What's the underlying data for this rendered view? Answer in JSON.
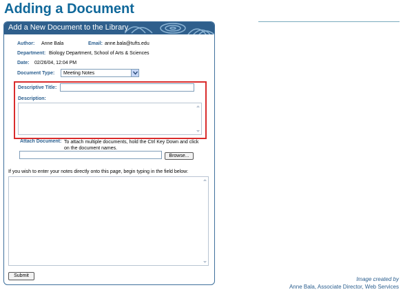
{
  "page": {
    "title": "Adding a Document"
  },
  "panel": {
    "header": "Add a New Document to the Library"
  },
  "form": {
    "author_label": "Author:",
    "author_value": "Anne Bala",
    "email_label": "Email:",
    "email_value": "anne.bala@tufts.edu",
    "department_label": "Department:",
    "department_value": "Biology Department, School of Arts & Sciences",
    "date_label": "Date:",
    "date_value": "02/26/04, 12:04 PM",
    "document_type_label": "Document Type:",
    "document_type_value": "Meeting Notes",
    "descriptive_title_label": "Descriptive Title:",
    "descriptive_title_value": "",
    "description_label": "Description:",
    "description_value": "",
    "attach_label": "Attach Document:",
    "attach_help": "To attach multiple documents, hold the Ctrl Key Down and click on the document names.",
    "attach_value": "",
    "browse_label": "Browse...",
    "notes_help": "If you wish to enter your notes directly onto this page, begin typing in the field below:",
    "notes_value": "",
    "submit_label": "Submit"
  },
  "credit": {
    "line1": "Image created by",
    "line2": "Anne Bala, Associate Director, Web Services"
  },
  "colors": {
    "title": "#10689a",
    "header_bg": "#2f5f8c",
    "label": "#2b5f8f",
    "highlight": "#d92b2b"
  },
  "icons": {
    "select_arrow": "chevron-down-icon",
    "scroll_up": "scroll-up-icon",
    "scroll_down": "scroll-down-icon"
  }
}
